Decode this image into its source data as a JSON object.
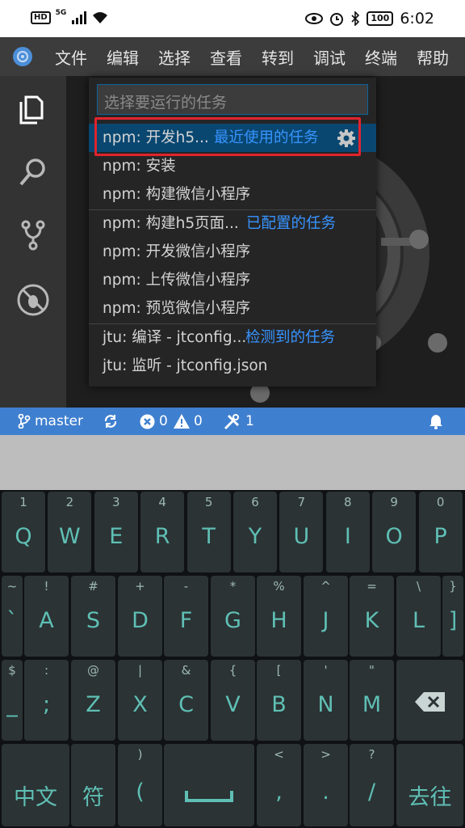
{
  "status_bar": {
    "hd": "HD",
    "network": "5G",
    "battery": "100",
    "time": "6:02"
  },
  "menu": {
    "items": [
      "文件",
      "编辑",
      "选择",
      "查看",
      "转到",
      "调试",
      "终端",
      "帮助"
    ]
  },
  "quick_pick": {
    "placeholder": "选择要运行的任务",
    "rows": [
      {
        "label": "npm: 开发h5...",
        "tag": "最近使用的任务"
      },
      {
        "label": "npm: 安装",
        "tag": ""
      },
      {
        "label": "npm: 构建微信小程序",
        "tag": ""
      },
      {
        "label": "npm: 构建h5页面...",
        "tag": "已配置的任务"
      },
      {
        "label": "npm: 开发微信小程序",
        "tag": ""
      },
      {
        "label": "npm: 上传微信小程序",
        "tag": ""
      },
      {
        "label": "npm: 预览微信小程序",
        "tag": ""
      },
      {
        "label": "jtu: 编译 - jtconfig...",
        "tag": "检测到的任务"
      },
      {
        "label": "jtu: 监听 - jtconfig.json",
        "tag": ""
      }
    ]
  },
  "vs_status": {
    "branch": "master",
    "errors": "0",
    "warnings": "0",
    "tasks": "1"
  },
  "keyboard": {
    "row1": [
      {
        "sub": "1",
        "main": "Q"
      },
      {
        "sub": "2",
        "main": "W"
      },
      {
        "sub": "3",
        "main": "E"
      },
      {
        "sub": "4",
        "main": "R"
      },
      {
        "sub": "5",
        "main": "T"
      },
      {
        "sub": "6",
        "main": "Y"
      },
      {
        "sub": "7",
        "main": "U"
      },
      {
        "sub": "8",
        "main": "I"
      },
      {
        "sub": "9",
        "main": "O"
      },
      {
        "sub": "0",
        "main": "P"
      }
    ],
    "row2": [
      {
        "sub": "~",
        "main": "`"
      },
      {
        "sub": "!",
        "main": "A"
      },
      {
        "sub": "#",
        "main": "S"
      },
      {
        "sub": "+",
        "main": "D"
      },
      {
        "sub": "-",
        "main": "F"
      },
      {
        "sub": "*",
        "main": "G"
      },
      {
        "sub": "%",
        "main": "H"
      },
      {
        "sub": "^",
        "main": "J"
      },
      {
        "sub": "=",
        "main": "K"
      },
      {
        "sub": "\\",
        "main": "L"
      },
      {
        "sub": "}",
        "main": "]"
      }
    ],
    "row3": [
      {
        "sub": "$",
        "main": "_"
      },
      {
        "sub": ":",
        "main": ";"
      },
      {
        "sub": "@",
        "main": "Z"
      },
      {
        "sub": "|",
        "main": "X"
      },
      {
        "sub": "&",
        "main": "C"
      },
      {
        "sub": "{",
        "main": "V"
      },
      {
        "sub": "[",
        "main": "B"
      },
      {
        "sub": "'",
        "main": "N"
      },
      {
        "sub": "\"",
        "main": "M"
      }
    ],
    "row4": [
      {
        "sub": "",
        "main": "中文"
      },
      {
        "sub": "",
        "main": "符"
      },
      {
        "sub": ")",
        "main": "("
      },
      {
        "sub": "<",
        "main": ","
      },
      {
        "sub": ">",
        "main": "."
      },
      {
        "sub": "?",
        "main": "/"
      },
      {
        "sub": "",
        "main": "去往"
      }
    ]
  },
  "colors": {
    "accent_blue": "#3794ff",
    "status_blue": "#3f7fcf",
    "highlight_red": "#e0242e",
    "key_text": "#5fbfb4"
  }
}
